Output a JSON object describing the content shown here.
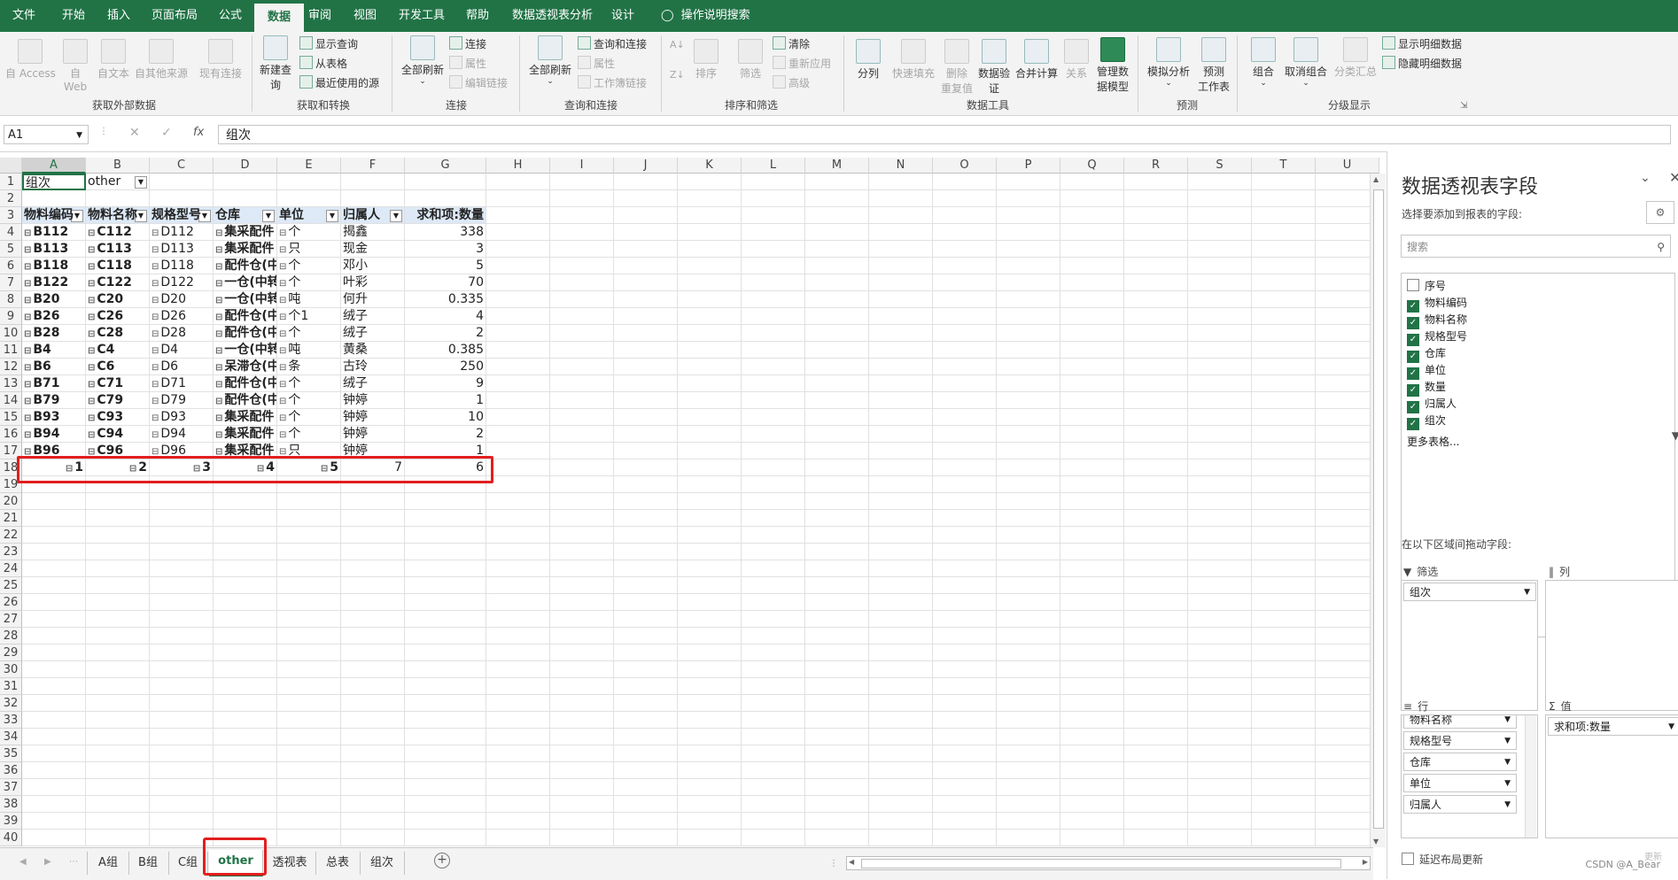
{
  "tabs": [
    "文件",
    "开始",
    "插入",
    "页面布局",
    "公式",
    "数据",
    "审阅",
    "视图",
    "开发工具",
    "帮助",
    "数据透视表分析",
    "设计"
  ],
  "active_tab": "数据",
  "tell_me": "操作说明搜索",
  "ribbon": {
    "ext": {
      "access": "自 Access",
      "web": "自\nWeb",
      "text": "自文本",
      "other": "自其他来源",
      "existing": "现有连接",
      "group": "获取外部数据"
    },
    "transform": {
      "newquery": "新建查\n询",
      "show": "显示查询",
      "fromtable": "从表格",
      "recent": "最近使用的源",
      "group": "获取和转换"
    },
    "conn": {
      "refreshall": "全部刷新",
      "connect": "连接",
      "props": "属性",
      "editlinks": "编辑链接",
      "group": "连接"
    },
    "qc": {
      "refreshall": "全部刷新",
      "qc": "查询和连接",
      "props": "属性",
      "wblinks": "工作簿链接",
      "group": "查询和连接"
    },
    "sort": {
      "sort": "排序",
      "filter": "筛选",
      "clear": "清除",
      "reapply": "重新应用",
      "advanced": "高级",
      "group": "排序和筛选"
    },
    "tools": {
      "split": "分列",
      "flash": "快速填充",
      "dup": "删除\n重复值",
      "validate": "数据验\n证",
      "consolidate": "合并计算",
      "relations": "关系",
      "model": "管理数\n据模型",
      "group": "数据工具"
    },
    "forecast": {
      "whatif": "模拟分析",
      "sheet": "预测\n工作表",
      "group": "预测"
    },
    "outline": {
      "group_btn": "组合",
      "ungroup": "取消组合",
      "subtotal": "分类汇总",
      "show": "显示明细数据",
      "hide": "隐藏明细数据",
      "group": "分级显示"
    }
  },
  "namebox": "A1",
  "formula": "组次",
  "columns": [
    "A",
    "B",
    "C",
    "D",
    "E",
    "F",
    "G",
    "H",
    "I",
    "J",
    "K",
    "L",
    "M",
    "N",
    "O",
    "P",
    "Q",
    "R",
    "S",
    "T",
    "U"
  ],
  "filter_row": {
    "label": "组次",
    "value": "other"
  },
  "headers": [
    "物料编码",
    "物料名称",
    "规格型号",
    "仓库",
    "单位",
    "归属人",
    "求和项:数量"
  ],
  "rows": [
    [
      "B112",
      "C112",
      "D112",
      "集采配件",
      "个",
      "揭鑫",
      "338"
    ],
    [
      "B113",
      "C113",
      "D113",
      "集采配件",
      "只",
      "现金",
      "3"
    ],
    [
      "B118",
      "C118",
      "D118",
      "配件仓(中",
      "个",
      "邓小",
      "5"
    ],
    [
      "B122",
      "C122",
      "D122",
      "一仓(中转",
      "个",
      "叶彩",
      "70"
    ],
    [
      "B20",
      "C20",
      "D20",
      "一仓(中转",
      "吨",
      "何升",
      "0.335"
    ],
    [
      "B26",
      "C26",
      "D26",
      "配件仓(中",
      "个1",
      "绒子",
      "4"
    ],
    [
      "B28",
      "C28",
      "D28",
      "配件仓(中",
      "个",
      "绒子",
      "2"
    ],
    [
      "B4",
      "C4",
      "D4",
      "一仓(中转",
      "吨",
      "黄桑",
      "0.385"
    ],
    [
      "B6",
      "C6",
      "D6",
      "呆滞仓(中",
      "条",
      "古玲",
      "250"
    ],
    [
      "B71",
      "C71",
      "D71",
      "配件仓(中",
      "个",
      "绒子",
      "9"
    ],
    [
      "B79",
      "C79",
      "D79",
      "配件仓(中",
      "个",
      "钟婷",
      "1"
    ],
    [
      "B93",
      "C93",
      "D93",
      "集采配件",
      "个",
      "钟婷",
      "10"
    ],
    [
      "B94",
      "C94",
      "D94",
      "集采配件",
      "个",
      "钟婷",
      "2"
    ],
    [
      "B96",
      "C96",
      "D96",
      "集采配件",
      "只",
      "钟婷",
      "1"
    ]
  ],
  "row18": [
    "1",
    "2",
    "3",
    "4",
    "5",
    "7",
    "6"
  ],
  "sheets": [
    "A组",
    "B组",
    "C组",
    "other",
    "透视表",
    "总表",
    "组次"
  ],
  "active_sheet": "other",
  "pane": {
    "title": "数据透视表字段",
    "subtitle": "选择要添加到报表的字段:",
    "search": "搜索",
    "fields": [
      {
        "name": "序号",
        "checked": false
      },
      {
        "name": "物料编码",
        "checked": true
      },
      {
        "name": "物料名称",
        "checked": true
      },
      {
        "name": "规格型号",
        "checked": true
      },
      {
        "name": "仓库",
        "checked": true
      },
      {
        "name": "单位",
        "checked": true
      },
      {
        "name": "数量",
        "checked": true
      },
      {
        "name": "归属人",
        "checked": true
      },
      {
        "name": "组次",
        "checked": true
      }
    ],
    "more": "更多表格...",
    "drag_hint": "在以下区域间拖动字段:",
    "filter_title": "筛选",
    "col_title": "列",
    "row_title": "行",
    "val_title": "值",
    "filter_item": "组次",
    "row_items": [
      "物料名称",
      "规格型号",
      "仓库",
      "单位",
      "归属人"
    ],
    "val_item": "求和项:数量",
    "defer": "延迟布局更新",
    "update": "更新"
  },
  "watermark": "CSDN @A_Bear"
}
